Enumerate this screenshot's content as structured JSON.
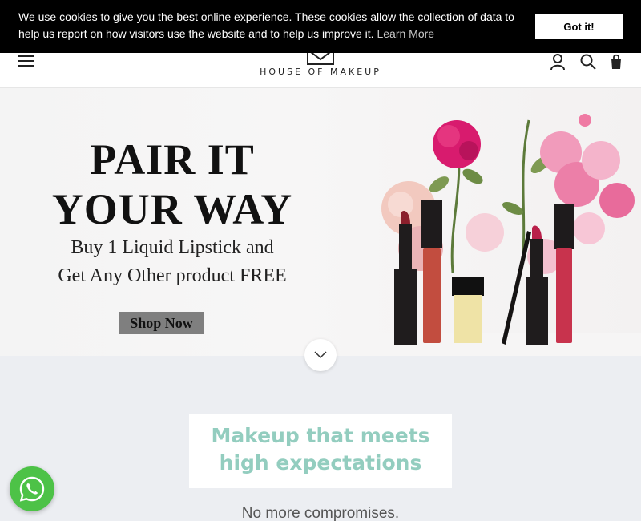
{
  "cookie": {
    "message": "We use cookies to give you the best online experience. These cookies allow the collection of data to help us report on how visitors use the website and to help us improve it.",
    "learn_more": "Learn More",
    "accept_label": "Got it!"
  },
  "header": {
    "logo_text": "HOUSE OF MAKEUP",
    "icons": [
      "menu-icon",
      "account-icon",
      "search-icon",
      "cart-icon"
    ]
  },
  "hero": {
    "headline_line1": "PAIR IT",
    "headline_line2": "YOUR WAY",
    "subline1": "Buy 1 Liquid Lipstick and",
    "subline2": "Get Any Other product FREE",
    "cta_label": "Shop Now"
  },
  "section": {
    "tagline_line1": "Makeup that meets",
    "tagline_line2": "high expectations",
    "intro": "No more compromises."
  },
  "colors": {
    "accent": "#93cdbf",
    "cookie_bg": "#000000",
    "whatsapp": "#4dc247"
  }
}
